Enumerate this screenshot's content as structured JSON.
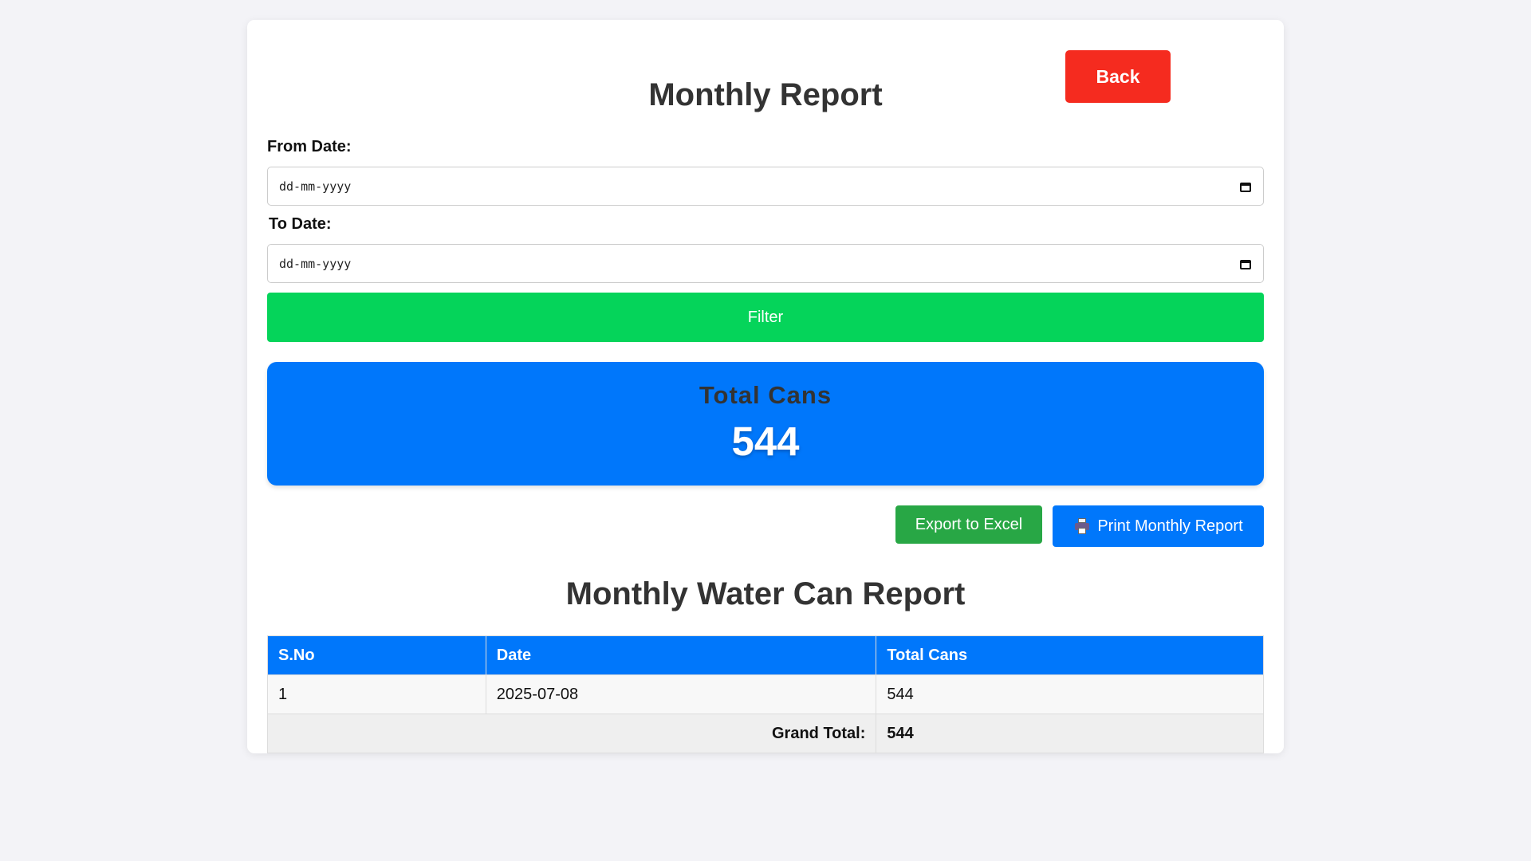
{
  "header": {
    "title": "Monthly Report",
    "back_label": "Back"
  },
  "filters": {
    "from_label": "From Date:",
    "from_placeholder": "dd-mm-yyyy",
    "to_label": "To Date:",
    "to_placeholder": "dd-mm-yyyy",
    "filter_label": "Filter"
  },
  "summary": {
    "label": "Total Cans",
    "value": "544"
  },
  "actions": {
    "export_label": "Export to Excel",
    "print_label": "Print Monthly Report",
    "print_icon": "printer-icon"
  },
  "report": {
    "title": "Monthly Water Can Report",
    "columns": [
      "S.No",
      "Date",
      "Total Cans"
    ],
    "rows": [
      {
        "sno": "1",
        "date": "2025-07-08",
        "total": "544"
      }
    ],
    "grand_total_label": "Grand Total:",
    "grand_total_value": "544"
  },
  "colors": {
    "back": "#f52b1f",
    "filter": "#05d45a",
    "primary": "#0077fb",
    "export": "#28a745"
  }
}
